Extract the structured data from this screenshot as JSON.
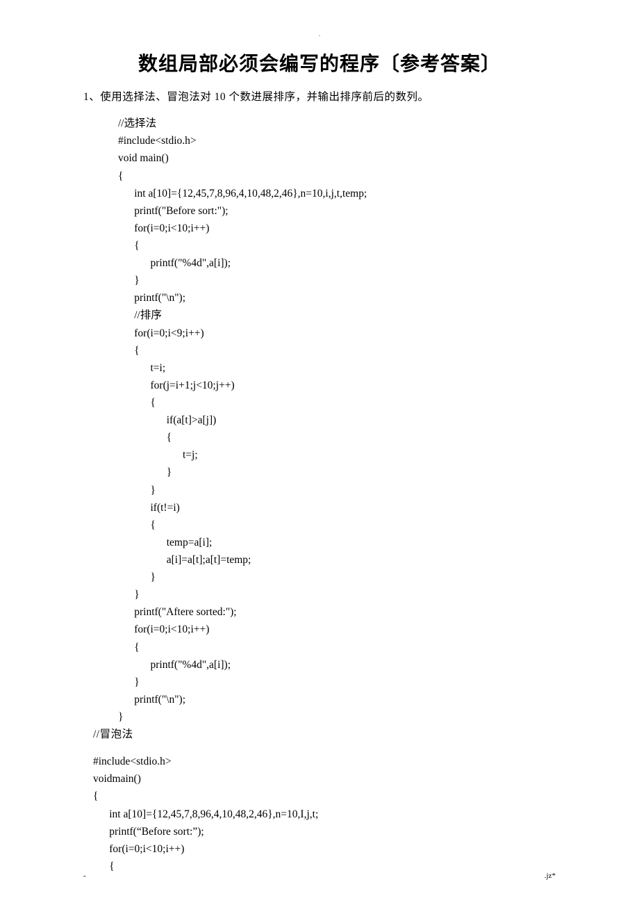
{
  "title": "数组局部必须会编写的程序〔参考答案〕",
  "intro": "1、使用选择法、冒泡法对 10 个数进展排序，并输出排序前后的数列。",
  "code_lines": [
    "//选择法",
    "#include<stdio.h>",
    "void main()",
    "{",
    "      int a[10]={12,45,7,8,96,4,10,48,2,46},n=10,i,j,t,temp;",
    "      printf(\"Before sort:\");",
    "      for(i=0;i<10;i++)",
    "      {",
    "            printf(\"%4d\",a[i]);",
    "      }",
    "      printf(\"\\n\");",
    "      //排序",
    "      for(i=0;i<9;i++)",
    "      {",
    "            t=i;",
    "            for(j=i+1;j<10;j++)",
    "            {",
    "                  if(a[t]>a[j])",
    "                  {",
    "                        t=j;",
    "                  }",
    "            }",
    "            if(t!=i)",
    "            {",
    "                  temp=a[i];",
    "                  a[i]=a[t];a[t]=temp;",
    "            }",
    "      }",
    "      printf(\"Aftere sorted:\");",
    "      for(i=0;i<10;i++)",
    "      {",
    "            printf(\"%4d\",a[i]);",
    "      }",
    "      printf(\"\\n\");",
    "}"
  ],
  "bubble_comment": "//冒泡法",
  "code2_lines": [
    "#include<stdio.h>",
    "voidmain()",
    "{",
    "      int a[10]={12,45,7,8,96,4,10,48,2,46},n=10,I,j,t;",
    "      printf(“Before sort:”);",
    "      for(i=0;i<10;i++)",
    "      {"
  ],
  "footer_left": "-",
  "footer_right": ".jz*",
  "top_dot": "."
}
